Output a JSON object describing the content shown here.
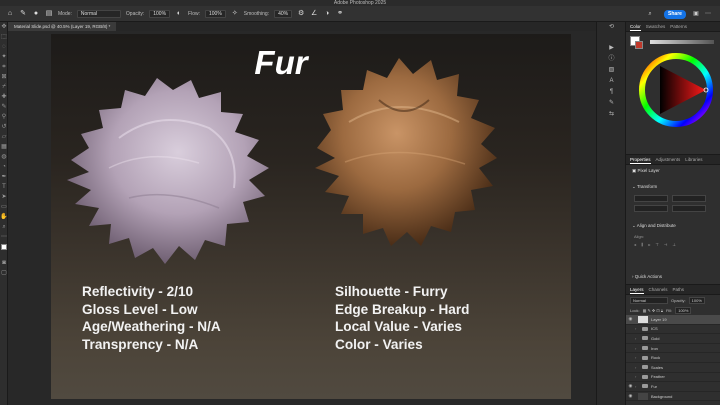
{
  "app": {
    "title": "Adobe Photoshop 2025"
  },
  "options_bar": {
    "mode_label": "Mode:",
    "mode_value": "Normal",
    "opacity_label": "Opacity:",
    "opacity_value": "100%",
    "flow_label": "Flow:",
    "flow_value": "100%",
    "smoothing_label": "Smoothing:",
    "smoothing_value": "40%",
    "share_label": "Share"
  },
  "document_tab": {
    "label": "Material Slide.psd @ 40.5% (Layer 19, RGB/8) *"
  },
  "artboard": {
    "title": "Fur",
    "left_properties": [
      "Reflectivity - 2/10",
      "Gloss Level - Low",
      "Age/Weathering - N/A",
      "Transprency - N/A"
    ],
    "right_properties": [
      "Silhouette - Furry",
      "Edge Breakup - Hard",
      "Local Value - Varies",
      "Color - Varies"
    ]
  },
  "color_panel": {
    "tabs": [
      "Color",
      "Swatches",
      "Patterns"
    ],
    "active_tab": "Color"
  },
  "properties_panel": {
    "tabs": [
      "Properties",
      "Adjustments",
      "Libraries"
    ],
    "active_tab": "Properties",
    "layer_kind": "Pixel Layer",
    "transform_label": "Transform",
    "align_label": "Align and Distribute",
    "align_sub": "Align:",
    "quick_actions_label": "Quick Actions"
  },
  "layers_panel": {
    "tabs": [
      "Layers",
      "Channels",
      "Paths"
    ],
    "active_tab": "Layers",
    "blend_mode": "Normal",
    "opacity_label": "Opacity:",
    "opacity_value": "100%",
    "lock_label": "Lock:",
    "fill_label": "Fill:",
    "fill_value": "100%",
    "layers": [
      {
        "name": "Layer 19",
        "kind": "pixel",
        "visible": true,
        "selected": true
      },
      {
        "name": "ICS",
        "kind": "folder",
        "visible": false,
        "selected": false
      },
      {
        "name": "Gold",
        "kind": "folder",
        "visible": false,
        "selected": false
      },
      {
        "name": "Iron",
        "kind": "folder",
        "visible": false,
        "selected": false
      },
      {
        "name": "Rock",
        "kind": "folder",
        "visible": false,
        "selected": false
      },
      {
        "name": "Scales",
        "kind": "folder",
        "visible": false,
        "selected": false
      },
      {
        "name": "Feather",
        "kind": "folder",
        "visible": false,
        "selected": false
      },
      {
        "name": "Fur",
        "kind": "folder",
        "visible": true,
        "selected": false
      },
      {
        "name": "Background",
        "kind": "pixel-dark",
        "visible": true,
        "selected": false
      }
    ]
  },
  "colors": {
    "accent": "#1473e6",
    "fur_left": "#b7a9b9",
    "fur_right": "#8a5a34"
  }
}
